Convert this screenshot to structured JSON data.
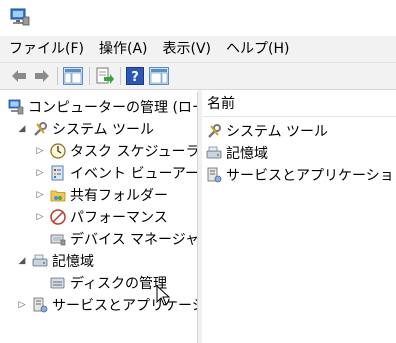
{
  "menu": {
    "items": [
      {
        "label": "ファイル(F)"
      },
      {
        "label": "操作(A)"
      },
      {
        "label": "表示(V)"
      },
      {
        "label": "ヘルプ(H)"
      }
    ]
  },
  "toolbar": {
    "buttons": [
      "back-arrow-icon",
      "forward-arrow-icon",
      "show-hide-tree-icon",
      "export-list-icon",
      "help-icon",
      "show-hide-action-pane-icon"
    ]
  },
  "tree": {
    "root": {
      "label": "コンピューターの管理 (ローカ"
    },
    "system_tools": {
      "label": "システム ツール",
      "children": [
        {
          "label": "タスク スケジューラ"
        },
        {
          "label": "イベント ビューアー"
        },
        {
          "label": "共有フォルダー"
        },
        {
          "label": "パフォーマンス"
        },
        {
          "label": "デバイス マネージャー"
        }
      ]
    },
    "storage": {
      "label": "記憶域",
      "children": [
        {
          "label": "ディスクの管理"
        }
      ]
    },
    "services": {
      "label": "サービスとアプリケーション"
    }
  },
  "list": {
    "header": "名前",
    "items": [
      {
        "label": "システム ツール"
      },
      {
        "label": "記憶域"
      },
      {
        "label": "サービスとアプリケーション"
      }
    ]
  }
}
